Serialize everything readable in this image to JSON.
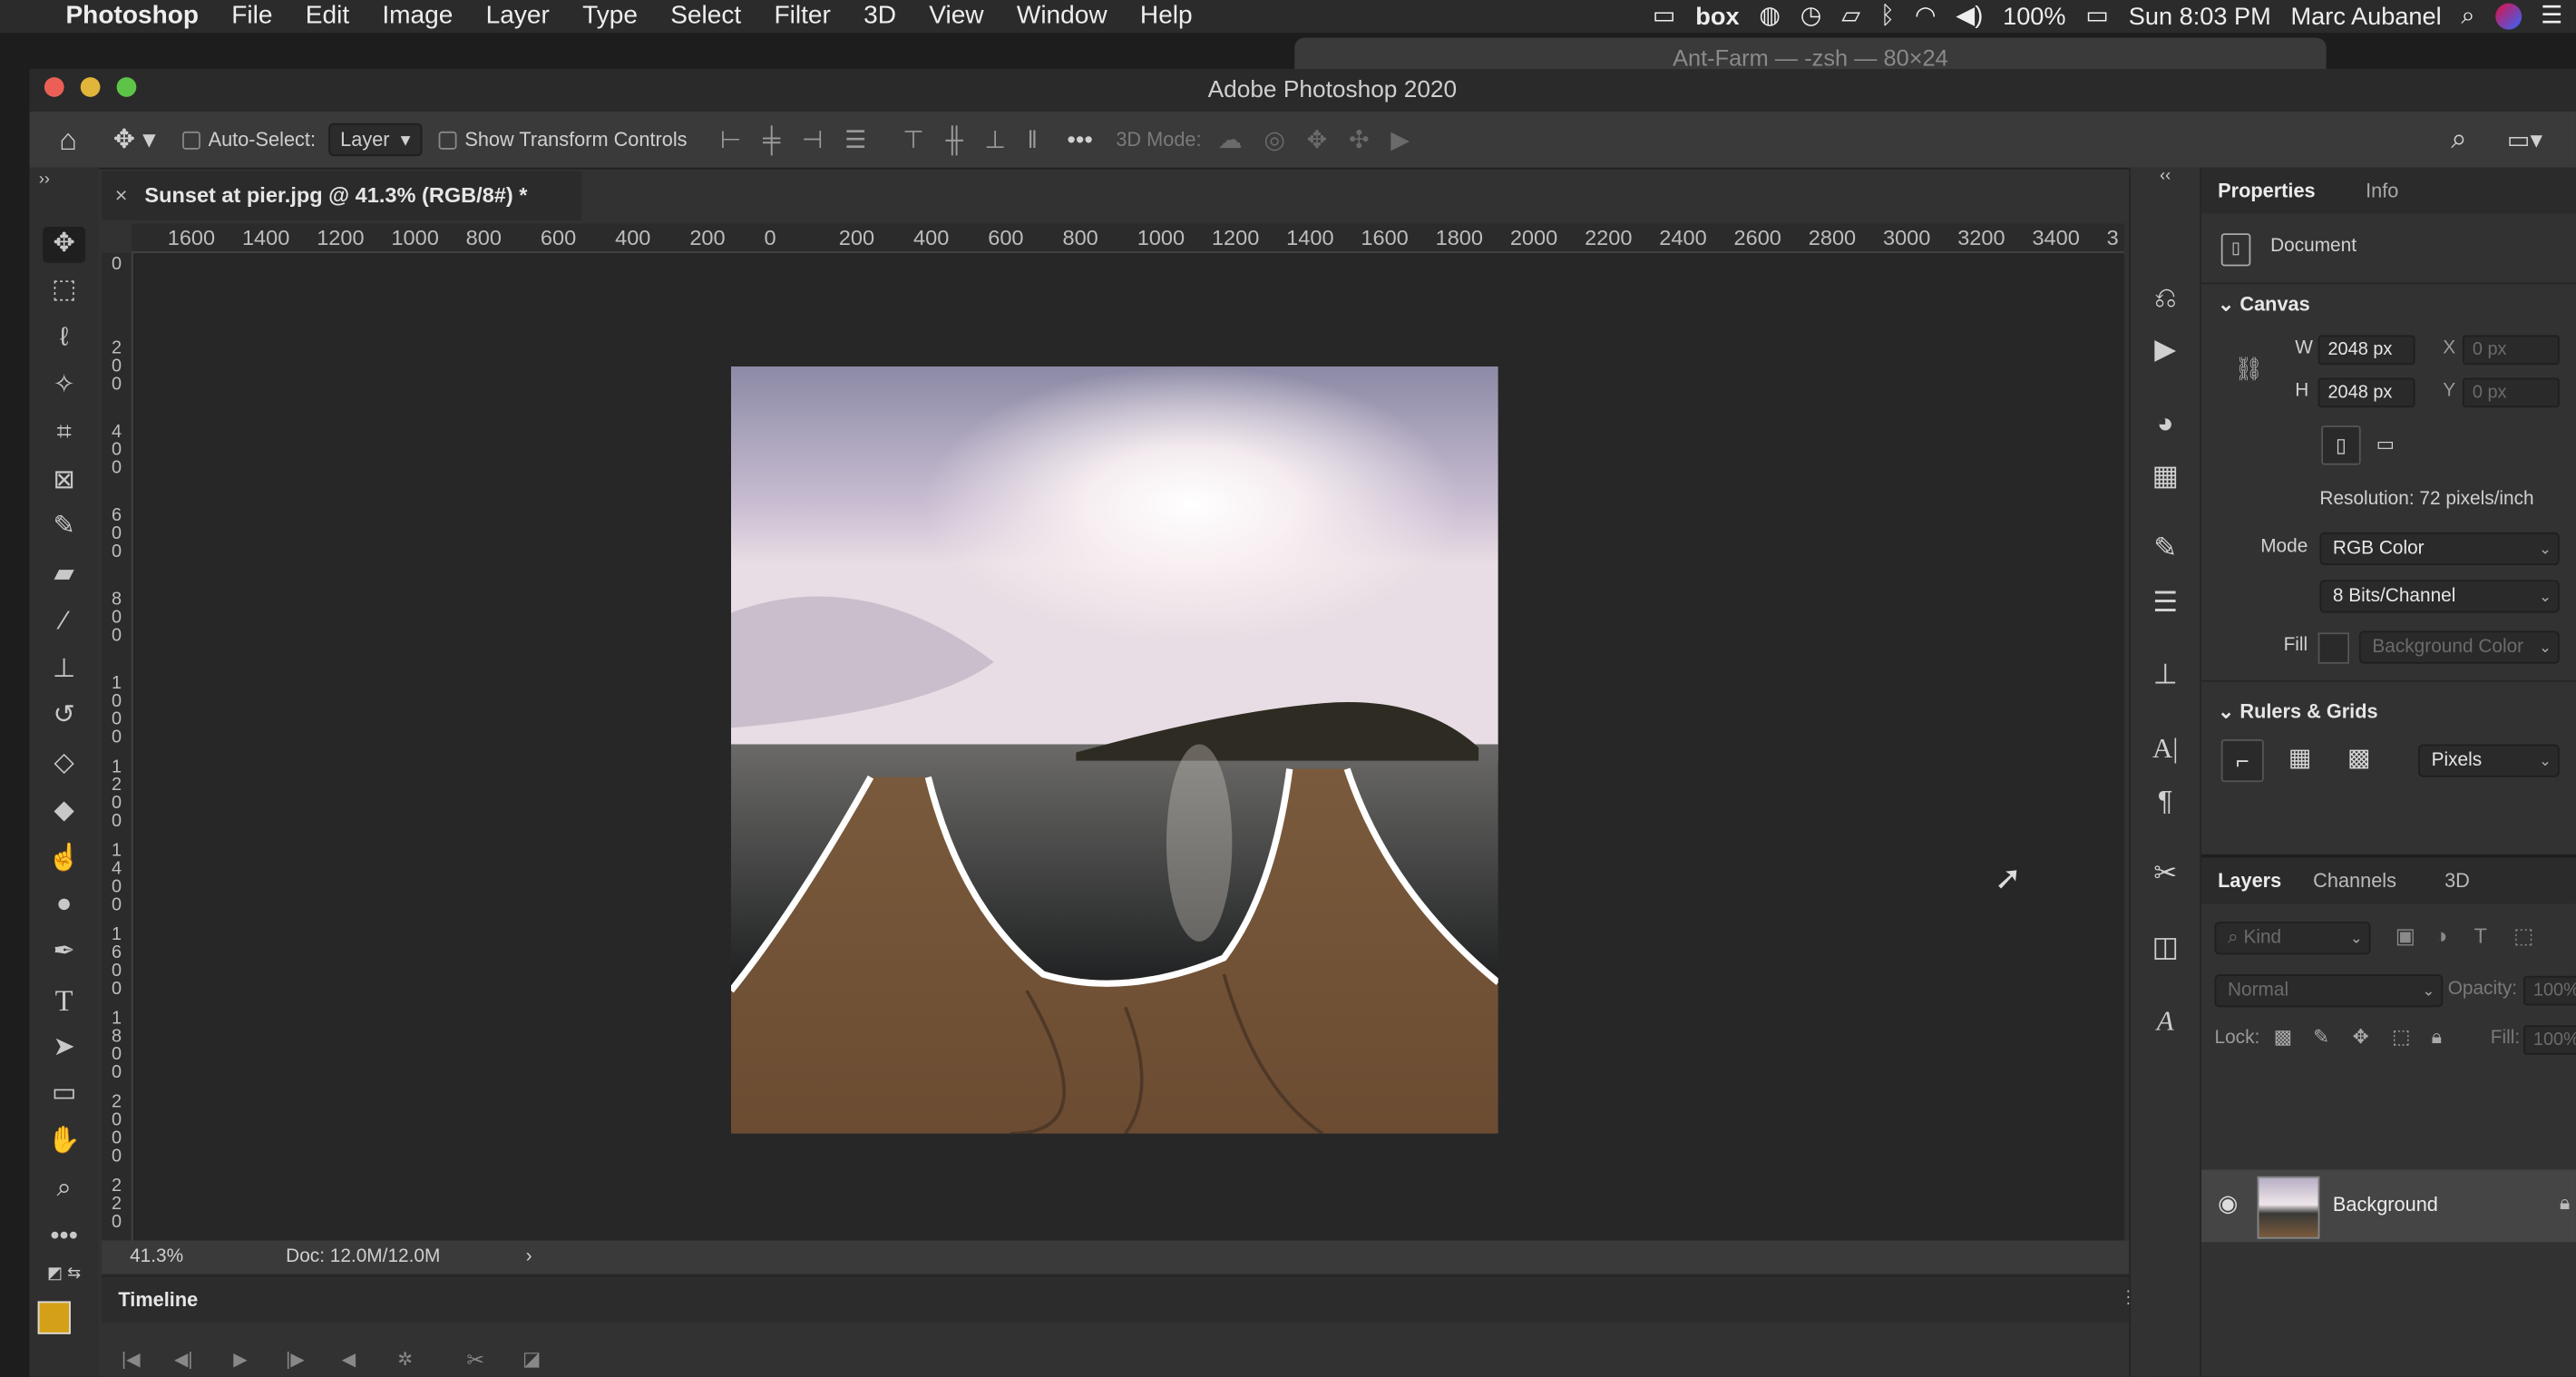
{
  "menubar": {
    "app_name": "Photoshop",
    "items": [
      "File",
      "Edit",
      "Image",
      "Layer",
      "Type",
      "Select",
      "Filter",
      "3D",
      "View",
      "Window",
      "Help"
    ],
    "status": {
      "box": "box",
      "battery": "100%",
      "clock": "Sun 8:03 PM",
      "user": "Marc Aubanel"
    }
  },
  "background_window": {
    "title": "Ant-Farm — -zsh — 80×24"
  },
  "window": {
    "title": "Adobe Photoshop 2020"
  },
  "options_bar": {
    "auto_select_label": "Auto-Select:",
    "auto_select_value": "Layer",
    "show_transform_label": "Show Transform Controls",
    "mode_3d_label": "3D Mode:"
  },
  "document": {
    "tab_title": "Sunset at pier.jpg @ 41.3% (RGB/8#) *",
    "zoom": "41.3%",
    "doc_size": "Doc: 12.0M/12.0M"
  },
  "rulers": {
    "horizontal": [
      "1600",
      "1400",
      "1200",
      "1000",
      "800",
      "600",
      "400",
      "200",
      "0",
      "200",
      "400",
      "600",
      "800",
      "1000",
      "1200",
      "1400",
      "1600",
      "1800",
      "2000",
      "2200",
      "2400",
      "2600",
      "2800",
      "3000",
      "3200",
      "3400",
      "3"
    ],
    "vertical": [
      "0",
      "2 0 0",
      "4 0 0",
      "6 0 0",
      "8 0 0",
      "1 0 0 0",
      "1 2 0 0",
      "1 4 0 0",
      "1 6 0 0",
      "1 8 0 0",
      "2 0 0 0",
      "2 2 0"
    ]
  },
  "timeline": {
    "title": "Timeline"
  },
  "properties": {
    "tabs": [
      "Properties",
      "Info"
    ],
    "section_label": "Document",
    "canvas_header": "Canvas",
    "w_label": "W",
    "w_value": "2048 px",
    "h_label": "H",
    "h_value": "2048 px",
    "x_label": "X",
    "x_value": "0 px",
    "y_label": "Y",
    "y_value": "0 px",
    "resolution": "Resolution: 72 pixels/inch",
    "mode_label": "Mode",
    "mode_value": "RGB Color",
    "depth_value": "8 Bits/Channel",
    "fill_label": "Fill",
    "fill_value": "Background Color",
    "rulers_header": "Rulers & Grids",
    "units_value": "Pixels"
  },
  "layers": {
    "tabs": [
      "Layers",
      "Channels",
      "3D"
    ],
    "kind_placeholder": "Kind",
    "blend_mode": "Normal",
    "opacity_label": "Opacity:",
    "opacity_value": "100%",
    "lock_label": "Lock:",
    "fill_label": "Fill:",
    "fill_value": "100%",
    "items": [
      {
        "name": "Background"
      }
    ]
  },
  "colors": {
    "foreground": "#d4a017",
    "background": "#5b2a8c",
    "accent": "#3a3a3a"
  }
}
